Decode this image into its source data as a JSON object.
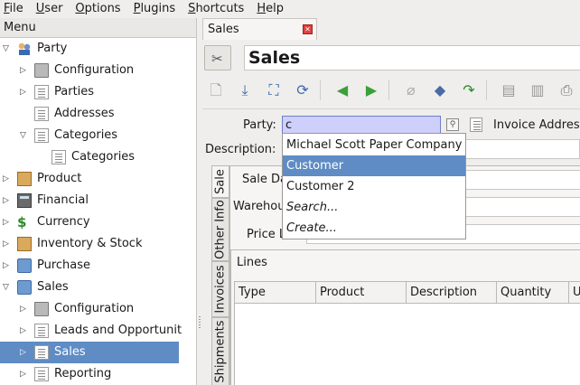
{
  "menubar": [
    {
      "label": "File",
      "key": "F",
      "rest": "ile"
    },
    {
      "label": "User",
      "key": "U",
      "rest": "ser"
    },
    {
      "label": "Options",
      "key": "O",
      "rest": "ptions"
    },
    {
      "label": "Plugins",
      "key": "P",
      "rest": "lugins"
    },
    {
      "label": "Shortcuts",
      "key": "S",
      "rest": "hortcuts"
    },
    {
      "label": "Help",
      "key": "H",
      "rest": "elp"
    }
  ],
  "menu": {
    "header": "Menu",
    "items": [
      {
        "label": "Party",
        "icon": "people-icon",
        "expander": "expanded"
      },
      {
        "label": "Configuration",
        "icon": "config-icon",
        "expander": "collapsed"
      },
      {
        "label": "Parties",
        "icon": "document-icon",
        "expander": "collapsed"
      },
      {
        "label": "Addresses",
        "icon": "document-icon",
        "expander": "none"
      },
      {
        "label": "Categories",
        "icon": "document-icon",
        "expander": "expanded"
      },
      {
        "label": "Categories",
        "icon": "document-icon",
        "expander": "none"
      },
      {
        "label": "Product",
        "icon": "box-icon",
        "expander": "collapsed"
      },
      {
        "label": "Financial",
        "icon": "calculator-icon",
        "expander": "collapsed"
      },
      {
        "label": "Currency",
        "icon": "currency-icon",
        "expander": "collapsed"
      },
      {
        "label": "Inventory & Stock",
        "icon": "box-icon",
        "expander": "collapsed"
      },
      {
        "label": "Purchase",
        "icon": "folder-icon",
        "expander": "collapsed"
      },
      {
        "label": "Sales",
        "icon": "folder-icon",
        "expander": "expanded"
      },
      {
        "label": "Configuration",
        "icon": "config-icon",
        "expander": "collapsed"
      },
      {
        "label": "Leads and Opportunit",
        "icon": "document-icon",
        "expander": "collapsed"
      },
      {
        "label": "Sales",
        "icon": "document-icon",
        "expander": "collapsed",
        "selected": true
      },
      {
        "label": "Reporting",
        "icon": "document-icon",
        "expander": "collapsed"
      }
    ]
  },
  "tab": {
    "label": "Sales",
    "close_icon": "close-icon"
  },
  "form_title": "Sales",
  "toolbar_icons": [
    "new-icon",
    "save-icon",
    "switch-view-icon",
    "reload-icon",
    "previous-icon",
    "next-icon",
    "attachment-icon",
    "action-icon",
    "relate-icon",
    "copy-icon",
    "duplicate-icon",
    "print-icon"
  ],
  "form": {
    "party_label": "Party:",
    "party_value": "c",
    "invoice_address_label": "Invoice Addres",
    "description_label": "Description:",
    "sale_date_label": "Sale Da",
    "warehouse_label": "Warehou",
    "price_list_label": "Price L",
    "lines_label": "Lines",
    "side_tabs": [
      "Sale",
      "Other Info",
      "Invoices",
      "Shipments"
    ],
    "lines_columns": [
      "Type",
      "Product",
      "Description",
      "Quantity",
      "U"
    ]
  },
  "autocomplete": {
    "options": [
      {
        "label": "Michael Scott Paper Company",
        "selected": false,
        "italic": false
      },
      {
        "label": "Customer",
        "selected": true,
        "italic": false
      },
      {
        "label": "Customer 2",
        "selected": false,
        "italic": false
      },
      {
        "label": "Search...",
        "selected": false,
        "italic": true
      },
      {
        "label": "Create...",
        "selected": false,
        "italic": true
      }
    ]
  },
  "colors": {
    "selection": "#5f8cc4",
    "party_field": "#cfcffb"
  }
}
